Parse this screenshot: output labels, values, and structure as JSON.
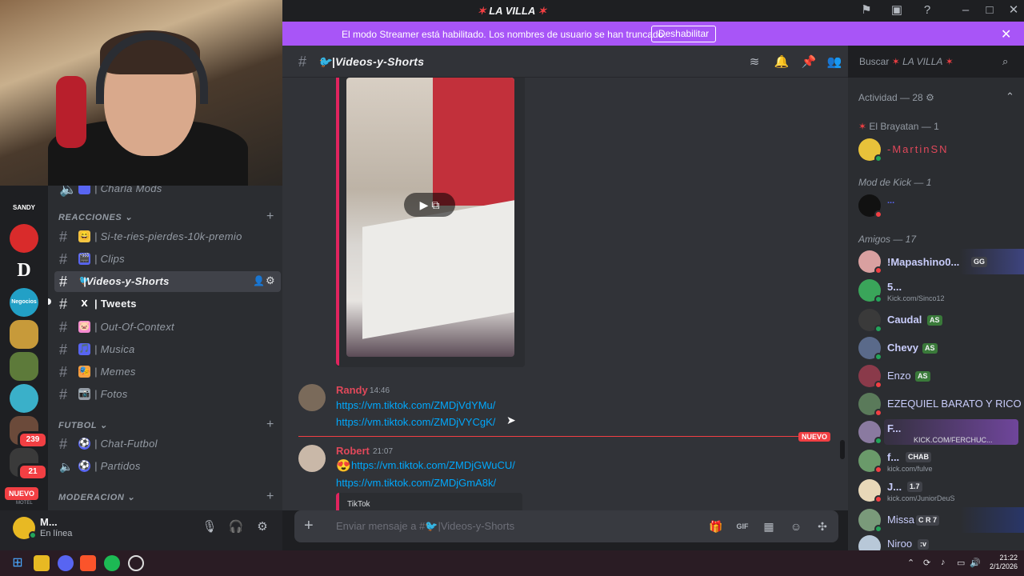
{
  "window": {
    "title": "LA VILLA",
    "title_emoji_left": "✶",
    "title_emoji_right": "✶"
  },
  "banner": {
    "text": "El modo Streamer está habilitado. Los nombres de usuario se han truncado.",
    "button": "Deshabilitar"
  },
  "servers": [
    {
      "label": "SANDY MOTORS",
      "color": "#1e1f22"
    },
    {
      "label": "",
      "color": "#d92b2b"
    },
    {
      "label": "D",
      "color": "#1e1f22"
    },
    {
      "label": "Negocios Dvx",
      "color": "#22a0c6"
    },
    {
      "label": "",
      "color": "#c79a3a"
    },
    {
      "label": "",
      "color": "#5d7a3a"
    },
    {
      "label": "",
      "color": "#3ab0c9"
    },
    {
      "label": "",
      "color": "#6b4a3a",
      "badge": "239"
    },
    {
      "label": "",
      "color": "#3a3a3a",
      "badge": "21"
    }
  ],
  "new_badge": "NUEVO",
  "server_name_bottom": "MOTEL",
  "channels": {
    "prev": "| Charla Mods",
    "categories": [
      {
        "name": "REACCIONES",
        "items": [
          {
            "emoji": "😄",
            "name": "| Si-te-ries-pierdes-10k-premio",
            "color": "#f5c542"
          },
          {
            "emoji": "🎬",
            "name": "| Clips",
            "color": "#5865f2"
          },
          {
            "emoji": "🐦",
            "name": "|Videos-y-Shorts",
            "color": "#ffffff",
            "active": true
          },
          {
            "emoji": "X",
            "name": "| Tweets",
            "color": "#ffffff",
            "unread": true
          },
          {
            "emoji": "🐷",
            "name": "| Out-Of-Context",
            "color": "#f58ad0"
          },
          {
            "emoji": "🎵",
            "name": "| Musica",
            "color": "#5865f2"
          },
          {
            "emoji": "🎭",
            "name": "| Memes",
            "color": "#f5a142"
          },
          {
            "emoji": "📷",
            "name": "| Fotos",
            "color": "#949ba4"
          }
        ]
      },
      {
        "name": "FUTBOL",
        "items": [
          {
            "emoji": "⚽",
            "name": "| Chat-Futbol",
            "color": "#5865f2"
          },
          {
            "emoji": "⚽",
            "name": "| Partidos",
            "color": "#5865f2"
          }
        ]
      },
      {
        "name": "MODERACION",
        "items": []
      }
    ]
  },
  "user_panel": {
    "name": "M...",
    "status": "En línea"
  },
  "chat_header": {
    "channel": "🐦|Videos-y-Shorts"
  },
  "search": {
    "placeholder": "Buscar",
    "server": "LA VILLA"
  },
  "messages": [
    {
      "author": "Randy",
      "time": "14:46",
      "color": "#e0485a",
      "links": [
        "https://vm.tiktok.com/ZMDjVdYMu/",
        "https://vm.tiktok.com/ZMDjVYCgK/"
      ]
    },
    {
      "author": "Robert",
      "time": "21:07",
      "color": "#e0485a",
      "prefix_emoji": "😍",
      "links": [
        "https://vm.tiktok.com/ZMDjGWuCU/",
        "https://vm.tiktok.com/ZMDjGmA8k/"
      ],
      "embed_provider": "TikTok"
    }
  ],
  "new_marker": "NUEVO",
  "composer": {
    "placeholder": "Enviar mensaje a #🐦|Videos-y-Shorts"
  },
  "members": {
    "header": "Actividad — 28",
    "groups": [
      {
        "label": "El Brayatan — 1",
        "members": [
          {
            "name": "-MartinSN",
            "color": "#e0485a",
            "avatar": "#e8c23a",
            "status": "#23a55a"
          }
        ]
      },
      {
        "label": "Mod de Kick — 1",
        "italic": true,
        "members": [
          {
            "name": "...",
            "color": "#5865f2",
            "avatar": "#111111",
            "status": "#f23f43"
          }
        ]
      },
      {
        "label": "Amigos — 17",
        "italic": true,
        "members": [
          {
            "name": "!Mapashino0...",
            "color": "#c9cdfb",
            "avatar": "#d9a0a0",
            "status": "#f23f43",
            "tag": "GG"
          },
          {
            "name": "5...",
            "color": "#c9cdfb",
            "avatar": "#3aa55a",
            "status": "#23a55a",
            "sub": "Kick.com/Sinco12"
          },
          {
            "name": "Caudal",
            "color": "#c9cdfb",
            "avatar": "#3a3a3a",
            "status": "#23a55a",
            "tag": "AS"
          },
          {
            "name": "Chevy",
            "color": "#c9cdfb",
            "avatar": "#5a6a8a",
            "status": "#23a55a",
            "tag": "AS"
          },
          {
            "name": "Enzo",
            "color": "#c9cdfb",
            "avatar": "#8a3a4a",
            "status": "#f23f43",
            "tag": "AS"
          },
          {
            "name": "EZEQUIEL BARATO Y RICO",
            "color": "#c9cdfb",
            "avatar": "#5a7a5a",
            "status": "#f23f43"
          },
          {
            "name": "F...",
            "color": "#c9cdfb",
            "avatar": "#8a7aa0",
            "status": "#23a55a",
            "sub": "KICK.COM/FERCHUC..."
          },
          {
            "name": "f...",
            "color": "#c9cdfb",
            "avatar": "#6a9a6a",
            "status": "#f23f43",
            "tag": "CHAB",
            "sub": "kick.com/fulve"
          },
          {
            "name": "J...",
            "color": "#c9cdfb",
            "avatar": "#e8d8b8",
            "status": "#f23f43",
            "tag": "1.7",
            "sub": "kick.com/JuniorDeuS"
          },
          {
            "name": "Missa",
            "color": "#c9cdfb",
            "avatar": "#7a9a7a",
            "status": "#23a55a",
            "tag": "C R 7"
          },
          {
            "name": "Niroo",
            "color": "#c9cdfb",
            "avatar": "#b8c8d8",
            "status": "#f23f43",
            "tag": ":v"
          }
        ]
      }
    ]
  },
  "taskbar": {
    "time": "21:22",
    "date": "2/1/2026"
  }
}
